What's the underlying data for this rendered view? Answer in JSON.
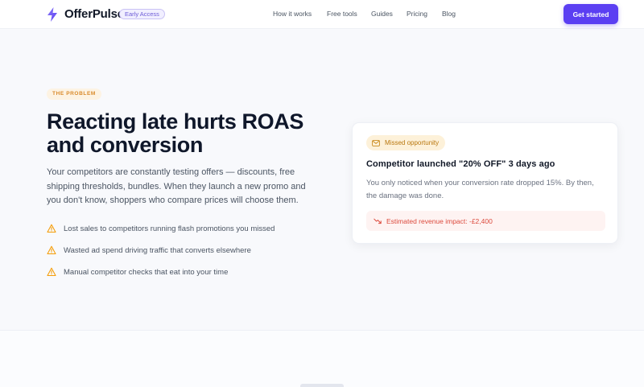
{
  "header": {
    "brand": "OfferPulse",
    "badge": "Early Access",
    "nav": [
      "How it works",
      "Free tools",
      "Guides",
      "Pricing",
      "Blog"
    ],
    "cta": "Get started"
  },
  "hero": {
    "eyebrow": "THE PROBLEM",
    "title_line1": "Reacting late hurts ROAS",
    "title_line2": "and conversion",
    "lead_lines": [
      "Your competitors are constantly testing offers — discounts, free",
      "shipping thresholds, bundles. When they launch a new promo and",
      "you don't know, shoppers who compare prices will choose them."
    ],
    "bullets": [
      "Lost sales to competitors running flash promotions you missed",
      "Wasted ad spend driving traffic that converts elsewhere",
      "Manual competitor checks that eat into your time"
    ]
  },
  "card": {
    "chip": "Missed opportunity",
    "title": "Competitor launched \"20% OFF\" 3 days ago",
    "body_lines": [
      "You only noticed when your conversion rate dropped 15%. By then,",
      "the damage was done."
    ],
    "impact": "Estimated revenue impact: -£2,400"
  },
  "icons": {
    "logo": "lightning-bolt-icon",
    "warning": "warning-triangle-icon",
    "mail": "envelope-icon",
    "trend": "trending-down-icon"
  },
  "colors": {
    "accent": "#5b3ff2",
    "warning": "#f59e0b",
    "danger": "#dc4a3d"
  }
}
